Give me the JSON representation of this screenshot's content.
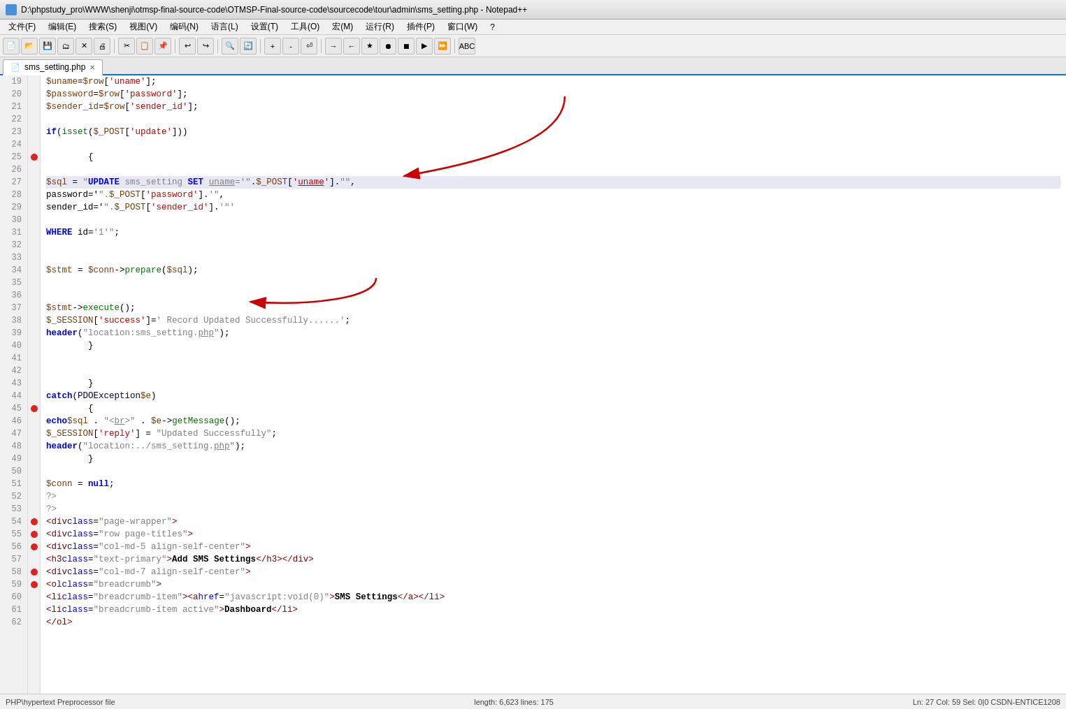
{
  "title_bar": {
    "text": "D:\\phpstudy_pro\\WWW\\shenji\\otmsp-final-source-code\\OTMSP-Final-source-code\\sourcecode\\tour\\admin\\sms_setting.php - Notepad++"
  },
  "menu_bar": {
    "items": [
      "文件(F)",
      "编辑(E)",
      "搜索(S)",
      "视图(V)",
      "编码(N)",
      "语言(L)",
      "设置(T)",
      "工具(O)",
      "宏(M)",
      "运行(R)",
      "插件(P)",
      "窗口(W)",
      "?"
    ]
  },
  "tab": {
    "label": "sms_setting.php",
    "has_close": true
  },
  "status_bar": {
    "left": "PHP\\hypertext Preprocessor file",
    "middle": "length: 6,623    lines: 175",
    "right": "Ln: 27    Col: 59    Sel: 0|0    CSDN-ENTICE1208"
  },
  "code_lines": [
    {
      "num": 19,
      "bookmark": false,
      "highlighted": false,
      "text": "        $uname=$row['uname'];"
    },
    {
      "num": 20,
      "bookmark": false,
      "highlighted": false,
      "text": "        $password=$row['password'];"
    },
    {
      "num": 21,
      "bookmark": false,
      "highlighted": false,
      "text": "        $sender_id=$row['sender_id'];"
    },
    {
      "num": 22,
      "bookmark": false,
      "highlighted": false,
      "text": ""
    },
    {
      "num": 23,
      "bookmark": false,
      "highlighted": false,
      "text": "        if(isset($_POST['update']))"
    },
    {
      "num": 24,
      "bookmark": false,
      "highlighted": false,
      "text": ""
    },
    {
      "num": 25,
      "bookmark": true,
      "highlighted": false,
      "text": "        {"
    },
    {
      "num": 26,
      "bookmark": false,
      "highlighted": false,
      "text": ""
    },
    {
      "num": 27,
      "bookmark": false,
      "highlighted": true,
      "text": "            $sql = \"UPDATE sms_setting SET uname='\".$_POST['uname'].\"',"
    },
    {
      "num": 28,
      "bookmark": false,
      "highlighted": false,
      "text": "        password='\".$_POST['password'].'\"',"
    },
    {
      "num": 29,
      "bookmark": false,
      "highlighted": false,
      "text": "        sender_id='\".$_POST['sender_id'].'\"'"
    },
    {
      "num": 30,
      "bookmark": false,
      "highlighted": false,
      "text": ""
    },
    {
      "num": 31,
      "bookmark": false,
      "highlighted": false,
      "text": "            WHERE id='1'\";"
    },
    {
      "num": 32,
      "bookmark": false,
      "highlighted": false,
      "text": ""
    },
    {
      "num": 33,
      "bookmark": false,
      "highlighted": false,
      "text": ""
    },
    {
      "num": 34,
      "bookmark": false,
      "highlighted": false,
      "text": "        $stmt = $conn->prepare($sql);"
    },
    {
      "num": 35,
      "bookmark": false,
      "highlighted": false,
      "text": ""
    },
    {
      "num": 36,
      "bookmark": false,
      "highlighted": false,
      "text": ""
    },
    {
      "num": 37,
      "bookmark": false,
      "highlighted": false,
      "text": "        $stmt->execute();"
    },
    {
      "num": 38,
      "bookmark": false,
      "highlighted": false,
      "text": "        $_SESSION['success']=' Record Updated Successfully......';"
    },
    {
      "num": 39,
      "bookmark": false,
      "highlighted": false,
      "text": "            header(\"location:sms_setting.php\");"
    },
    {
      "num": 40,
      "bookmark": false,
      "highlighted": false,
      "text": "        }"
    },
    {
      "num": 41,
      "bookmark": false,
      "highlighted": false,
      "text": ""
    },
    {
      "num": 42,
      "bookmark": false,
      "highlighted": false,
      "text": ""
    },
    {
      "num": 43,
      "bookmark": false,
      "highlighted": false,
      "text": "        }"
    },
    {
      "num": 44,
      "bookmark": false,
      "highlighted": false,
      "text": "    catch(PDOException $e)"
    },
    {
      "num": 45,
      "bookmark": true,
      "highlighted": false,
      "text": "        {"
    },
    {
      "num": 46,
      "bookmark": false,
      "highlighted": false,
      "text": "        echo $sql . \"<br>\" . $e->getMessage();"
    },
    {
      "num": 47,
      "bookmark": false,
      "highlighted": false,
      "text": "        $_SESSION['reply'] = \"Updated Successfully\";"
    },
    {
      "num": 48,
      "bookmark": false,
      "highlighted": false,
      "text": "    header(\"location:../sms_setting.php\");"
    },
    {
      "num": 49,
      "bookmark": false,
      "highlighted": false,
      "text": "        }"
    },
    {
      "num": 50,
      "bookmark": false,
      "highlighted": false,
      "text": ""
    },
    {
      "num": 51,
      "bookmark": false,
      "highlighted": false,
      "text": "    $conn = null;"
    },
    {
      "num": 52,
      "bookmark": false,
      "highlighted": false,
      "text": "    ?>"
    },
    {
      "num": 53,
      "bookmark": false,
      "highlighted": false,
      "text": "    ?>"
    },
    {
      "num": 54,
      "bookmark": true,
      "highlighted": false,
      "text": "    <div class=\"page-wrapper\">"
    },
    {
      "num": 55,
      "bookmark": true,
      "highlighted": false,
      "text": "    <div class=\"row page-titles\">"
    },
    {
      "num": 56,
      "bookmark": true,
      "highlighted": false,
      "text": "                <div class=\"col-md-5 align-self-center\">"
    },
    {
      "num": 57,
      "bookmark": false,
      "highlighted": false,
      "text": "                        <h3 class=\"text-primary\">Add SMS Settings</h3> </div>"
    },
    {
      "num": 58,
      "bookmark": true,
      "highlighted": false,
      "text": "                <div class=\"col-md-7 align-self-center\">"
    },
    {
      "num": 59,
      "bookmark": true,
      "highlighted": false,
      "text": "                        <ol class=\"breadcrumb\">"
    },
    {
      "num": 60,
      "bookmark": false,
      "highlighted": false,
      "text": "                            <li class=\"breadcrumb-item\"><a href=\"javascript:void(0)\">SMS Settings</a></li>"
    },
    {
      "num": 61,
      "bookmark": false,
      "highlighted": false,
      "text": "                            <li class=\"breadcrumb-item active\">Dashboard</li>"
    },
    {
      "num": 62,
      "bookmark": false,
      "highlighted": false,
      "text": "                            </ol>"
    }
  ],
  "arrows": [
    {
      "id": "arrow1",
      "from_note": "points to line 27 uname area",
      "direction": "down-left"
    },
    {
      "id": "arrow2",
      "from_note": "points to line 31 WHERE area",
      "direction": "down-left"
    }
  ]
}
